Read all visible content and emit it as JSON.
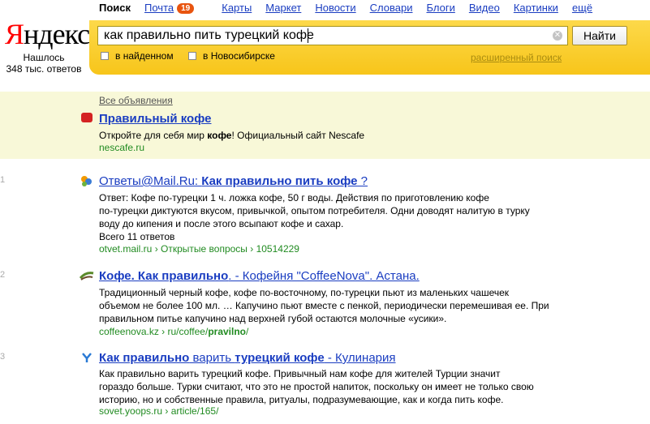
{
  "logo": {
    "first": "Я",
    "rest": "ндекс"
  },
  "found": {
    "line1": "Нашлось",
    "line2": "348 тыс. ответов"
  },
  "nav": {
    "search": "Поиск",
    "mail": "Почта",
    "mail_badge": "19",
    "maps": "Карты",
    "market": "Маркет",
    "news": "Новости",
    "dict": "Словари",
    "blogs": "Блоги",
    "video": "Видео",
    "images": "Картинки",
    "more": "ещё"
  },
  "search": {
    "query": "как правильно пить турецкий кофе",
    "button": "Найти"
  },
  "options": {
    "found_in": "в найденном",
    "city": "в Новосибирске",
    "advanced": "расширенный поиск"
  },
  "ad": {
    "header": "Все объявления",
    "title": "Правильный кофе",
    "text_pre": "Откройте для себя мир ",
    "text_bold": "кофе",
    "text_post": "! Официальный сайт Nescafe",
    "url": "nescafe.ru"
  },
  "results": [
    {
      "num": "1",
      "title_a": "Ответы@Mail.Ru: ",
      "title_b": "Как правильно пить кофе",
      "title_c": " ?",
      "snippet": [
        "Ответ: Кофе по-турецки 1 ч. ложка кофе, 50 г воды. Действия по приготовлению кофе",
        "по-турецки диктуются вкусом, привычкой, опытом потребителя. Одни доводят налитую в турку",
        "воду до кипения и после этого всыпают кофе и сахар.",
        "Всего 11 ответов"
      ],
      "url": "otvet.mail.ru › Открытые вопросы › 10514229"
    },
    {
      "num": "2",
      "title_a": "Кофе",
      "title_b": ". Как правильно",
      "title_c": ". - Кофейня \"CoffeeNova\". Астана.",
      "snippet": [
        "Традиционный черный кофе, кофе по-восточному, по-турецки пьют из маленьких чашечек",
        "объемом не более 100 мл. … Капучино пьют вместе с пенкой, периодически перемешивая ее. При",
        "правильном питье капучино над верхней губой остаются молочные «усики»."
      ],
      "url_a": "coffeenova.kz › ru/coffee/",
      "url_b": "pravilno",
      "url_c": "/"
    },
    {
      "num": "3",
      "title_a": "Как правильно",
      "title_b": " варить ",
      "title_c": "турецкий кофе",
      "title_d": " - Кулинария",
      "snippet": [
        "Как правильно варить турецкий кофе. Привычный нам кофе для жителей Турции значит",
        "гораздо больше. Турки считают, что это не простой напиток, поскольку он имеет не только свою",
        "историю, но и собственные правила, ритуалы, подразумевающие, как и когда пить кофе."
      ],
      "url": "sovet.yoops.ru › article/165/"
    }
  ]
}
